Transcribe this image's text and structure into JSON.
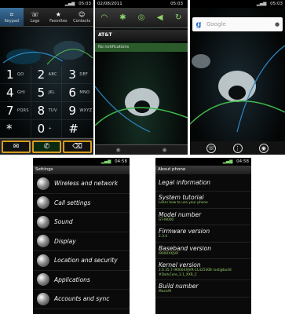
{
  "dialer": {
    "status_time": "05:03",
    "tabs": [
      {
        "icon": "keypad-icon",
        "glyph": "⌗",
        "label": "Keypad"
      },
      {
        "icon": "logs-icon",
        "glyph": "☏",
        "label": "Logs"
      },
      {
        "icon": "favorites-icon",
        "glyph": "★",
        "label": "Favorites"
      },
      {
        "icon": "contacts-icon",
        "glyph": "☺",
        "label": "Contacts"
      }
    ],
    "keys": [
      {
        "digit": "1",
        "letters": "QO"
      },
      {
        "digit": "2",
        "letters": "ABC"
      },
      {
        "digit": "3",
        "letters": "DEF"
      },
      {
        "digit": "4",
        "letters": "GHI"
      },
      {
        "digit": "5",
        "letters": "JKL"
      },
      {
        "digit": "6",
        "letters": "MNO"
      },
      {
        "digit": "7",
        "letters": "PQRS"
      },
      {
        "digit": "8",
        "letters": "TUV"
      },
      {
        "digit": "9",
        "letters": "WXYZ"
      },
      {
        "digit": "*",
        "letters": ""
      },
      {
        "digit": "0",
        "letters": "+"
      },
      {
        "digit": "#",
        "letters": ""
      }
    ],
    "actions": {
      "message": "✉",
      "call": "✆",
      "delete": "⌫"
    }
  },
  "notifications": {
    "status_date": "02/08/2011",
    "status_time": "05:03",
    "toggles": [
      "wifi-icon",
      "bluetooth-icon",
      "gps-icon",
      "sound-icon",
      "sync-icon"
    ],
    "toggle_glyphs": [
      "◠",
      "✱",
      "◎",
      "◀",
      "↻"
    ],
    "carrier": "AT&T",
    "no_notifications": "No notifications"
  },
  "home": {
    "status_time": "05:03",
    "search_placeholder": "Google",
    "search_logo": "g",
    "dock": [
      "☏",
      "⋮",
      "◉"
    ]
  },
  "settings": {
    "status_time": "04:58",
    "title": "Settings",
    "items": [
      "Wireless and network",
      "Call settings",
      "Sound",
      "Display",
      "Location and security",
      "Applications",
      "Accounts and sync"
    ]
  },
  "about": {
    "status_time": "04:58",
    "title": "About phone",
    "rows": [
      {
        "title": "Legal information",
        "sub": ""
      },
      {
        "title": "System tutorial",
        "sub": "Learn how to use your phone"
      },
      {
        "title": "Model number",
        "sub": "GT-I9000"
      },
      {
        "title": "Firmware version",
        "sub": "2.3.4"
      },
      {
        "title": "Baseband version",
        "sub": "I9000XXJVR"
      },
      {
        "title": "Kernel version",
        "sub": "2.6.35.7-I9000XXJVR-CL425308 root@build #DarkCore_3.1_XXR_C"
      },
      {
        "title": "Build number",
        "sub": "MusicM"
      }
    ]
  }
}
